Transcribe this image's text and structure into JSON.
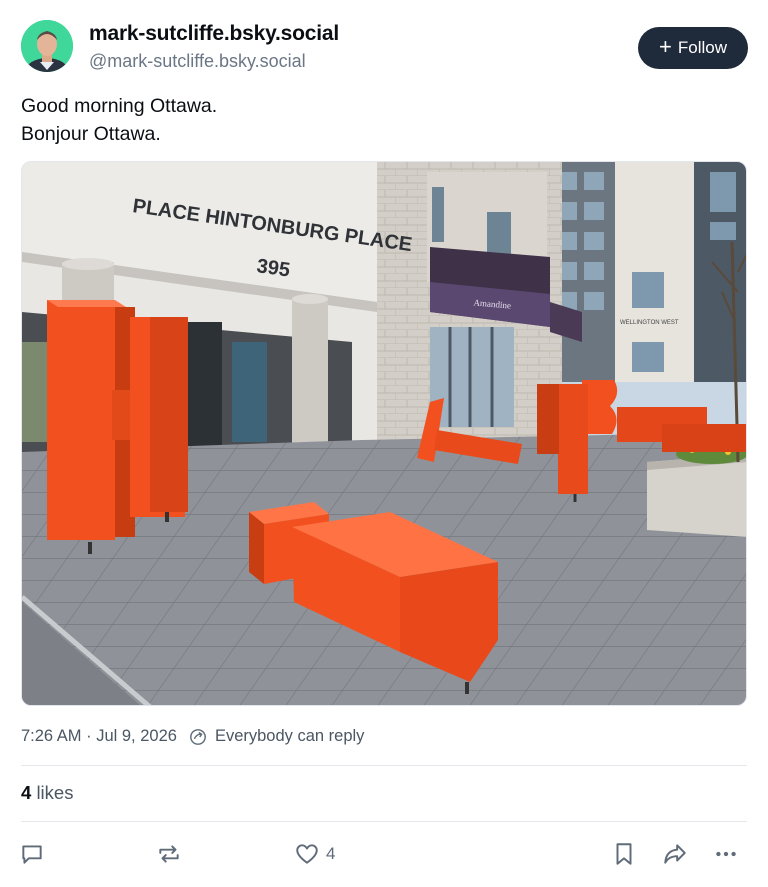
{
  "author": {
    "display_name": "mark-sutcliffe.bsky.social",
    "handle": "@mark-sutcliffe.bsky.social"
  },
  "follow_button": {
    "label": "Follow",
    "icon": "plus-icon"
  },
  "post": {
    "lines": [
      "Good morning Ottawa.",
      "Bonjour Ottawa."
    ]
  },
  "image": {
    "sign_line1": "PLACE HINTONBURG PLACE",
    "sign_number": "395",
    "awning_text": "Amandine",
    "building_sign": "WELLINGTON WEST"
  },
  "meta": {
    "timestamp": "7:26 AM · Jul 9, 2026",
    "reply_setting": "Everybody can reply"
  },
  "likes": {
    "count": "4",
    "label": "likes"
  },
  "actions": {
    "reply_icon": "comment-icon",
    "repost_icon": "repost-icon",
    "like_icon": "heart-icon",
    "like_count": "4",
    "bookmark_icon": "bookmark-icon",
    "share_icon": "share-icon",
    "more_icon": "more-icon"
  },
  "colors": {
    "follow_bg": "#1f2a3a",
    "letters": "#f2511f",
    "muted": "#6b7785"
  }
}
